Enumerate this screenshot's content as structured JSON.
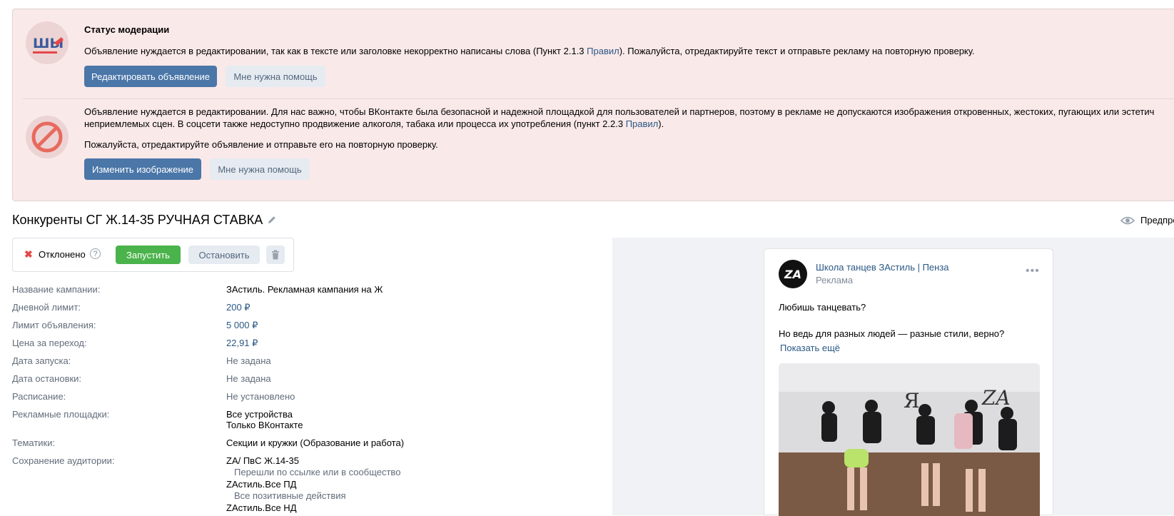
{
  "moderation": {
    "block1": {
      "title": "Статус модерации",
      "text_before": "Объявление нуждается в редактировании, так как в тексте или заголовке некорректно написаны слова (Пункт 2.1.3 ",
      "link": "Правил",
      "text_after": "). Пожалуйста, отредактируйте текст и отправьте рекламу на повторную проверку.",
      "primary_button": "Редактировать объявление",
      "secondary_button": "Мне нужна помощь"
    },
    "block2": {
      "line1": "Объявление нуждается в редактировании. Для нас важно, чтобы ВКонтакте была безопасной и надежной площадкой для пользователей и партнеров, поэтому в рекламе не допускаются изображения откровенных, жестоких, пугающих или эстетич",
      "line2_before": "неприемлемых сцен. В соцсети также недоступно продвижение алкоголя, табака или процесса их употребления (пункт 2.2.3 ",
      "link": "Правил",
      "line2_after": ").",
      "line3": "Пожалуйста, отредактируйте объявление и отправьте его на повторную проверку.",
      "primary_button": "Изменить изображение",
      "secondary_button": "Мне нужна помощь"
    }
  },
  "ad": {
    "title": "Конкуренты СГ Ж.14-35 РУЧНАЯ СТАВКА",
    "preview_label": "Предпро"
  },
  "status_bar": {
    "status": "Отклонено",
    "help": "?",
    "start_button": "Запустить",
    "stop_button": "Остановить"
  },
  "info": {
    "campaign_label": "Название кампании:",
    "campaign_value": "ЗАстиль. Рекламная кампания на Ж",
    "daily_limit_label": "Дневной лимит:",
    "daily_limit_value": "200 ₽",
    "ad_limit_label": "Лимит объявления:",
    "ad_limit_value": "5 000 ₽",
    "cpc_label": "Цена за переход:",
    "cpc_value": "22,91 ₽",
    "start_date_label": "Дата запуска:",
    "start_date_value": "Не задана",
    "stop_date_label": "Дата остановки:",
    "stop_date_value": "Не задана",
    "schedule_label": "Расписание:",
    "schedule_value": "Не установлено",
    "platforms_label": "Рекламные площадки:",
    "platforms_value1": "Все устройства",
    "platforms_value2": "Только ВКонтакте",
    "topics_label": "Тематики:",
    "topics_value": "Секции и кружки (Образование и работа)",
    "audience_label": "Сохранение аудитории:",
    "audience1_name": "ZA/ ПвС Ж.14-35",
    "audience1_desc": "Перешли по ссылке или в сообщество",
    "audience2_name": "ZАстиль.Все ПД",
    "audience2_desc": "Все позитивные действия",
    "audience3_name": "ZАстиль.Все НД"
  },
  "post": {
    "avatar_text": "ZA",
    "group_name": "Школа танцев ЗАстиль | Пенза",
    "subtitle": "Реклама",
    "more": "•••",
    "line1": "Любишь танцевать?",
    "line2": "Но ведь для разных людей — разные стили, верно?",
    "show_more": "Показать ещё",
    "wall_logo_left": "ZA",
    "wall_logo_right": "ZA"
  }
}
